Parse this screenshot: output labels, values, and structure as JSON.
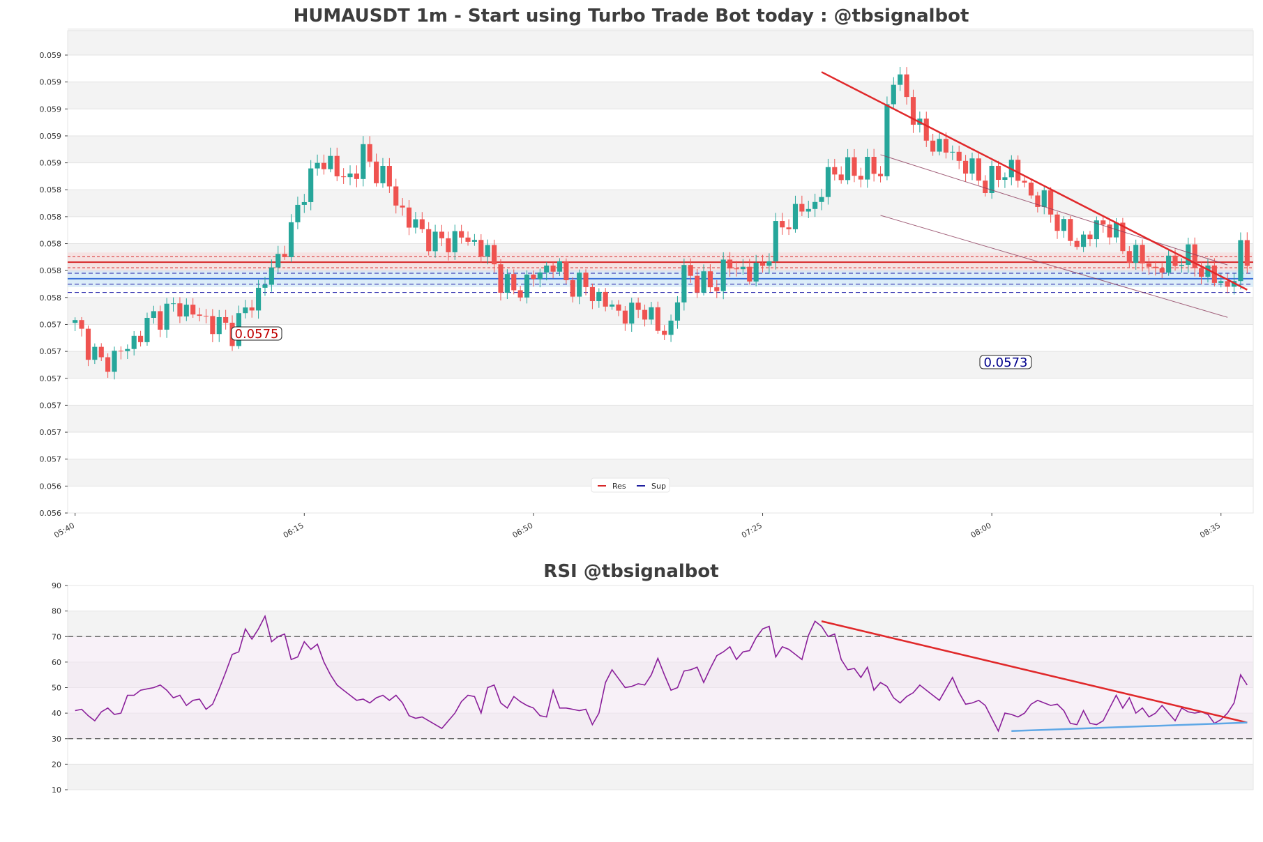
{
  "chart_data": [
    {
      "type": "candlestick",
      "title": "HUMAUSDT 1m - Start using Turbo Trade Bot today : @tbsignalbot",
      "y_tick_labels": [
        "0.056",
        "0.056",
        "0.057",
        "0.057",
        "0.057",
        "0.057",
        "0.057",
        "0.057",
        "0.058",
        "0.058",
        "0.058",
        "0.058",
        "0.058",
        "0.059",
        "0.059",
        "0.059",
        "0.059",
        "0.059"
      ],
      "ylim": [
        0.0561,
        0.05785
      ],
      "x_tick_labels": [
        "05:40",
        "06:15",
        "06:50",
        "07:25",
        "08:00",
        "08:35"
      ],
      "x_ticks_index": [
        0,
        35,
        70,
        105,
        140,
        175
      ],
      "candle_count": 180,
      "close_path": [
        [
          0,
          0.05678
        ],
        [
          4,
          0.05664
        ],
        [
          8,
          0.0567
        ],
        [
          12,
          0.05681
        ],
        [
          16,
          0.05685
        ],
        [
          20,
          0.0568
        ],
        [
          24,
          0.05676
        ],
        [
          28,
          0.0569
        ],
        [
          30,
          0.05698
        ],
        [
          33,
          0.05712
        ],
        [
          35,
          0.05728
        ],
        [
          37,
          0.05736
        ],
        [
          39,
          0.05738
        ],
        [
          41,
          0.0573
        ],
        [
          42,
          0.05732
        ],
        [
          44,
          0.0574
        ],
        [
          45,
          0.05736
        ],
        [
          47,
          0.05733
        ],
        [
          49,
          0.05723
        ],
        [
          51,
          0.05716
        ],
        [
          53,
          0.05712
        ],
        [
          55,
          0.05708
        ],
        [
          57,
          0.05709
        ],
        [
          59,
          0.0571
        ],
        [
          61,
          0.05708
        ],
        [
          63,
          0.05704
        ],
        [
          65,
          0.05695
        ],
        [
          67,
          0.0569
        ],
        [
          69,
          0.05694
        ],
        [
          71,
          0.05697
        ],
        [
          73,
          0.05701
        ],
        [
          75,
          0.05694
        ],
        [
          77,
          0.05693
        ],
        [
          79,
          0.0569
        ],
        [
          81,
          0.05686
        ],
        [
          83,
          0.05683
        ],
        [
          85,
          0.05682
        ],
        [
          87,
          0.05685
        ],
        [
          89,
          0.05676
        ],
        [
          91,
          0.05678
        ],
        [
          93,
          0.05698
        ],
        [
          95,
          0.05694
        ],
        [
          97,
          0.05692
        ],
        [
          99,
          0.05698
        ],
        [
          101,
          0.057
        ],
        [
          103,
          0.05696
        ],
        [
          105,
          0.057
        ],
        [
          107,
          0.05711
        ],
        [
          109,
          0.05717
        ],
        [
          111,
          0.0572
        ],
        [
          113,
          0.05722
        ],
        [
          115,
          0.05732
        ],
        [
          117,
          0.05735
        ],
        [
          119,
          0.05733
        ],
        [
          121,
          0.05736
        ],
        [
          123,
          0.05732
        ],
        [
          124,
          0.05758
        ],
        [
          125,
          0.05768
        ],
        [
          127,
          0.05762
        ],
        [
          129,
          0.05748
        ],
        [
          131,
          0.05744
        ],
        [
          133,
          0.05742
        ],
        [
          135,
          0.05738
        ],
        [
          137,
          0.05734
        ],
        [
          139,
          0.0573
        ],
        [
          141,
          0.05732
        ],
        [
          143,
          0.05736
        ],
        [
          145,
          0.05728
        ],
        [
          147,
          0.05724
        ],
        [
          149,
          0.0572
        ],
        [
          151,
          0.05712
        ],
        [
          153,
          0.05708
        ],
        [
          155,
          0.05711
        ],
        [
          157,
          0.05716
        ],
        [
          159,
          0.0571
        ],
        [
          161,
          0.05704
        ],
        [
          163,
          0.05702
        ],
        [
          165,
          0.05698
        ],
        [
          167,
          0.057
        ],
        [
          169,
          0.05703
        ],
        [
          171,
          0.05701
        ],
        [
          173,
          0.05696
        ],
        [
          175,
          0.05694
        ],
        [
          176,
          0.05692
        ],
        [
          177,
          0.05696
        ],
        [
          178,
          0.05705
        ],
        [
          179,
          0.05702
        ]
      ],
      "levels": {
        "resistance": [
          0.05699,
          0.05701,
          0.05703
        ],
        "support": [
          0.05697,
          0.05695,
          0.05693,
          0.0569
        ],
        "resistance_label": "0.0575",
        "support_label": "0.0573"
      },
      "trendline": {
        "from": [
          114,
          0.0577
        ],
        "to": [
          179,
          0.05691
        ]
      },
      "channel": [
        {
          "from": [
            123,
            0.0574
          ],
          "to": [
            176,
            0.057
          ]
        },
        {
          "from": [
            123,
            0.05718
          ],
          "to": [
            176,
            0.05681
          ]
        }
      ],
      "legend": [
        {
          "label": "Res",
          "color": "#d62728"
        },
        {
          "label": "Sup",
          "color": "#1f1f9f"
        }
      ],
      "colors": {
        "up": "#26a69a",
        "down": "#ef5350",
        "res": "#d62728",
        "sup": "#1a1aa6",
        "trend": "#e0282a",
        "channel": "#8b3a5a"
      }
    },
    {
      "type": "line",
      "title": "RSI @tbsignalbot",
      "y_ticks": [
        10,
        20,
        30,
        40,
        50,
        60,
        70,
        80,
        90
      ],
      "ylim": [
        10,
        90
      ],
      "overbought": 70,
      "oversold": 30,
      "series": [
        {
          "values": [
            41,
            41.5,
            39,
            37,
            40.5,
            42,
            39.5,
            40,
            47,
            47,
            49,
            49.5,
            50,
            51,
            49,
            46,
            47,
            43,
            45,
            45.5,
            41.5,
            43.5,
            49.5,
            56,
            63,
            64,
            73,
            69,
            73,
            78,
            68,
            70,
            71,
            61,
            62,
            68,
            65,
            67,
            60,
            55,
            51,
            49,
            47,
            45,
            45.5,
            44,
            46,
            47,
            45,
            47,
            44,
            39,
            38,
            38.5,
            37,
            35.5,
            34,
            37,
            40,
            44.5,
            47,
            46.5,
            40,
            50,
            51,
            44,
            42,
            46.5,
            44.5,
            43,
            42,
            39,
            38.5,
            49,
            42,
            42,
            41.5,
            41,
            41.5,
            35.5,
            40,
            52,
            57,
            53.5,
            50,
            50.5,
            51.5,
            51,
            55,
            61.5,
            55,
            49,
            50,
            56.5,
            57,
            58,
            52,
            57.5,
            62.5,
            64,
            66,
            61,
            64,
            64.5,
            69.5,
            73,
            74,
            62,
            66,
            65,
            63,
            61,
            70.5,
            76,
            74,
            70,
            71,
            61,
            57,
            57.5,
            54,
            58,
            49,
            52,
            50.5,
            46,
            44,
            46.5,
            48,
            51,
            49,
            47,
            45,
            49.5,
            54,
            48,
            43.5,
            44,
            45,
            43,
            38,
            33,
            40,
            39.5,
            38.5,
            40,
            43.5,
            45,
            44,
            43,
            43.5,
            41,
            36,
            35.5,
            41,
            36,
            35.5,
            37,
            42,
            47,
            42,
            46,
            40,
            42,
            38.5,
            40,
            43,
            40,
            37,
            42,
            40.5,
            40,
            40.5,
            39.5,
            36,
            37.5,
            40,
            44,
            55,
            51
          ]
        }
      ],
      "trendlines": [
        {
          "from": [
            114,
            76
          ],
          "to": [
            179,
            36.3
          ],
          "color": "#e0282a"
        },
        {
          "from": [
            143,
            33
          ],
          "to": [
            179,
            36.3
          ],
          "color": "#5ea7e6"
        }
      ],
      "colors": {
        "line": "#8a1f9a"
      }
    }
  ]
}
